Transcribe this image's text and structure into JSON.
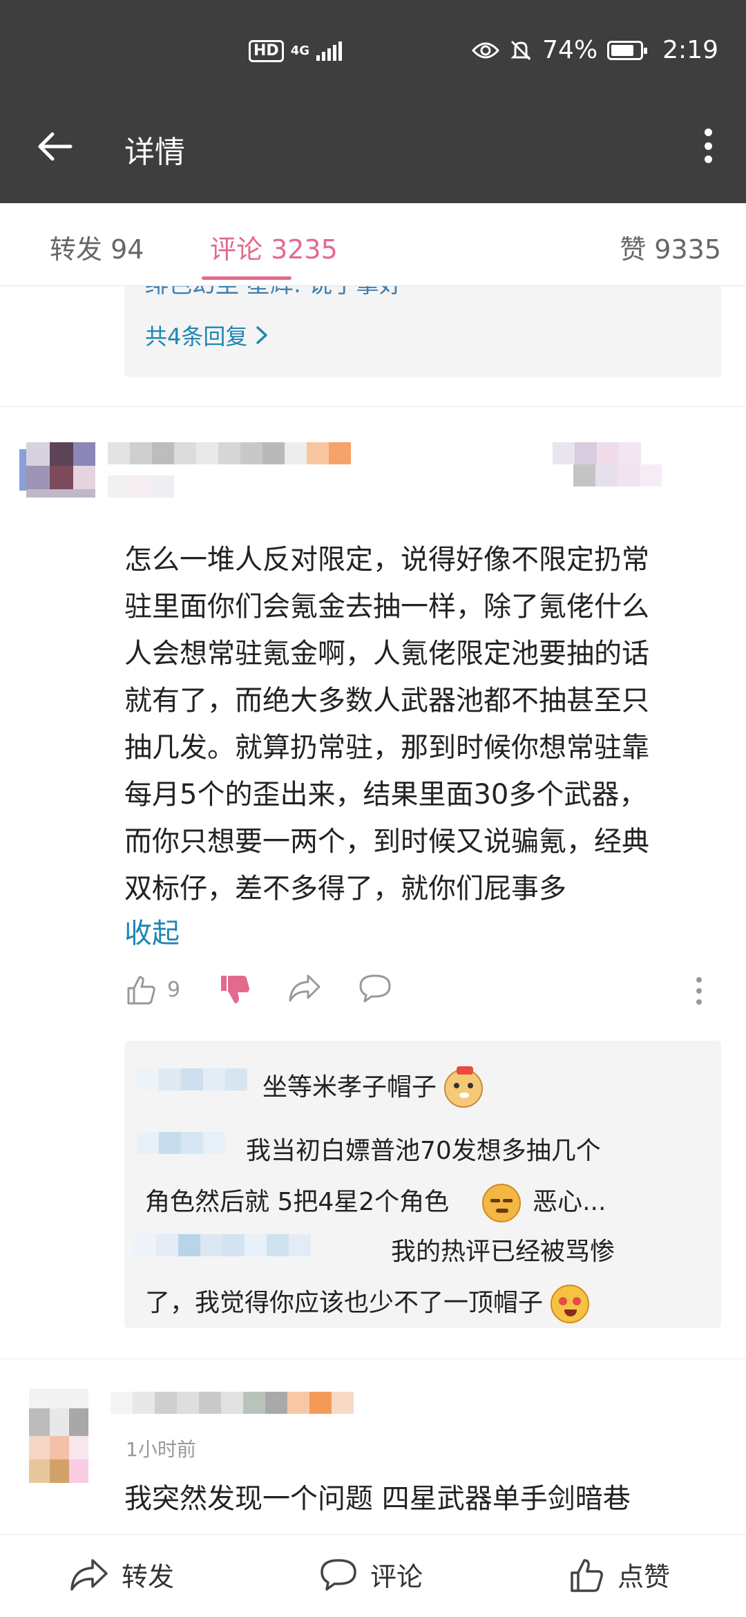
{
  "status_bar": {
    "hd": "HD",
    "network": "4G",
    "battery": "74%",
    "time": "2:19"
  },
  "header": {
    "title": "详情"
  },
  "tabs": [
    {
      "label": "转发 94"
    },
    {
      "label": "评论 3235"
    },
    {
      "label": "赞 9335"
    }
  ],
  "top_replies": {
    "cut_text": "绯色幻尘 星辉: 说了拿好",
    "more": "共4条回复"
  },
  "comment": {
    "lines": [
      "怎么一堆人反对限定，说得好像不限定扔常",
      "驻里面你们会氪金去抽一样，除了氪佬什么",
      "人会想常驻氪金啊，人氪佬限定池要抽的话",
      "就有了，而绝大多数人武器池都不抽甚至只",
      "抽几发。就算扔常驻，那到时候你想常驻靠",
      "每月5个的歪出来，结果里面30多个武器，",
      "而你只想要一两个，到时候又说骗氪，经典",
      "双标仔，差不多得了，就你们屁事多"
    ],
    "collapse": "收起",
    "like_count": "9",
    "replies": [
      {
        "text": "坐等米孝子帽子"
      },
      {
        "text1": "我当初白嫖普池70发想多抽几个",
        "text2": "角色然后就 5把4星2个角色",
        "text3": "恶心..."
      },
      {
        "text1": "我的热评已经被骂惨",
        "text2": "了，我觉得你应该也少不了一顶帽子"
      }
    ]
  },
  "comment2": {
    "time": "1小时前",
    "text": "我突然发现一个问题 四星武器单手剑暗巷"
  },
  "bottom_bar": {
    "repost": "转发",
    "comment": "评论",
    "like": "点赞"
  },
  "colors": {
    "accent": "#e36a8d",
    "link": "#1e86b2",
    "topbar": "#3e3e3e"
  }
}
